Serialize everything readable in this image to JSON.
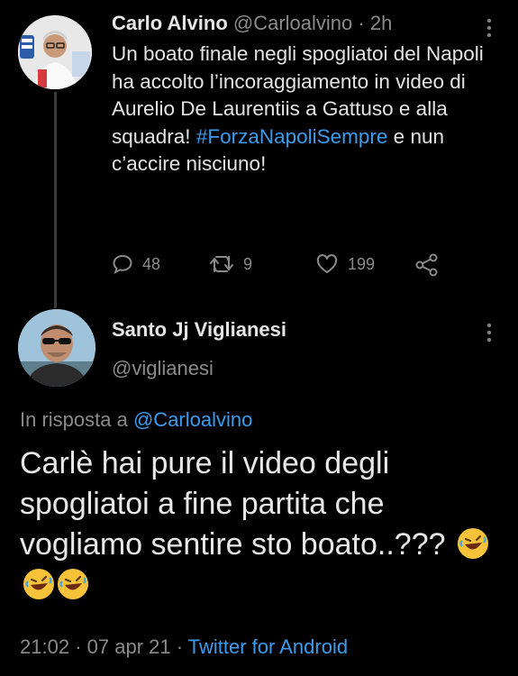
{
  "tweet1": {
    "author_name": "Carlo Alvino",
    "author_handle": "@Carloalvino",
    "separator": "·",
    "time": "2h",
    "text_before": "Un boato finale negli spogliatoi del Napoli ha accolto l’incoraggiamento in video di Aurelio De Laurentiis a Gattuso e alla squadra! ",
    "hashtag": "#ForzaNapoliSempre",
    "text_after": " e nun c’accire nisciuno!",
    "replies": "48",
    "retweets": "9",
    "likes": "199"
  },
  "tweet2": {
    "author_name": "Santo Jj Viglianesi",
    "author_handle": "@viglianesi",
    "reply_prefix": "In risposta a",
    "reply_to": "@Carloalvino",
    "text": "Carlè hai pure il video degli spogliatoi a fine partita che vogliamo sentire sto boato..???",
    "emoji_name": "rolling-on-the-floor-laughing",
    "time": "21:02",
    "date": "07 apr 21",
    "separator": "·",
    "source": "Twitter for Android"
  },
  "colors": {
    "background": "#000000",
    "link": "#3b9cec",
    "secondary_text": "#8a8a8a",
    "primary_text": "#e4e4e4"
  },
  "icons": [
    "kebab-menu-icon",
    "reply-icon",
    "retweet-icon",
    "like-icon",
    "share-icon"
  ]
}
